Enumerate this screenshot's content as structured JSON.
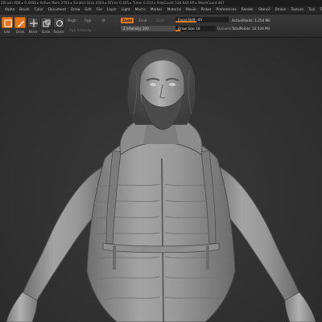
{
  "status_bar": {
    "text": "ZBrush 4R8 ▸ 0.4958 ▸ Active Mem 2793 ▸ Scratch Disk 4304 ▸ RTime 0.405 ▸ Timer 0.014 ▸ PolyCount 536.644 KP ▸ MeshCount 467"
  },
  "menu": [
    "Alpha",
    "Brush",
    "Color",
    "Document",
    "Draw",
    "Edit",
    "File",
    "Layer",
    "Light",
    "Macro",
    "Marker",
    "Material",
    "Movie",
    "Picker",
    "Preferences",
    "Render",
    "Stencil",
    "Stroke",
    "Texture",
    "Tool",
    "Transform",
    "Zplugin",
    "Zscript"
  ],
  "tools": [
    {
      "icon": "edit-icon",
      "label": "Edit",
      "active": true
    },
    {
      "icon": "draw-icon",
      "label": "Draw",
      "active": true
    },
    {
      "icon": "move-icon",
      "label": "Move",
      "active": false
    },
    {
      "icon": "scale-icon",
      "label": "Scale",
      "active": false
    },
    {
      "icon": "rotate-icon",
      "label": "Rotate",
      "active": false
    }
  ],
  "toolbar": {
    "mrgb": "Mrgb",
    "rgb": "Rgb",
    "m": "M",
    "rgb_intensity": "Rgb Intensity",
    "zadd": "Zadd",
    "zsub": "Zsub",
    "zcut": "Zcut",
    "focal_shift": "Focal Shift -40",
    "focal_shift_value": 0.4,
    "z_intensity": "Z Intensity 100",
    "z_intensity_value": 1.0,
    "draw_size": "Draw Size 18",
    "draw_size_value": 0.12,
    "dynamic": "Dynamic",
    "active_points": "ActivePoints: 1.250 Mil",
    "total_points": "TotalPoints: 10.536 Mil"
  },
  "colors": {
    "accent": "#e07a20",
    "viewport_bg": "#333333",
    "model": "#9a9a9a"
  }
}
